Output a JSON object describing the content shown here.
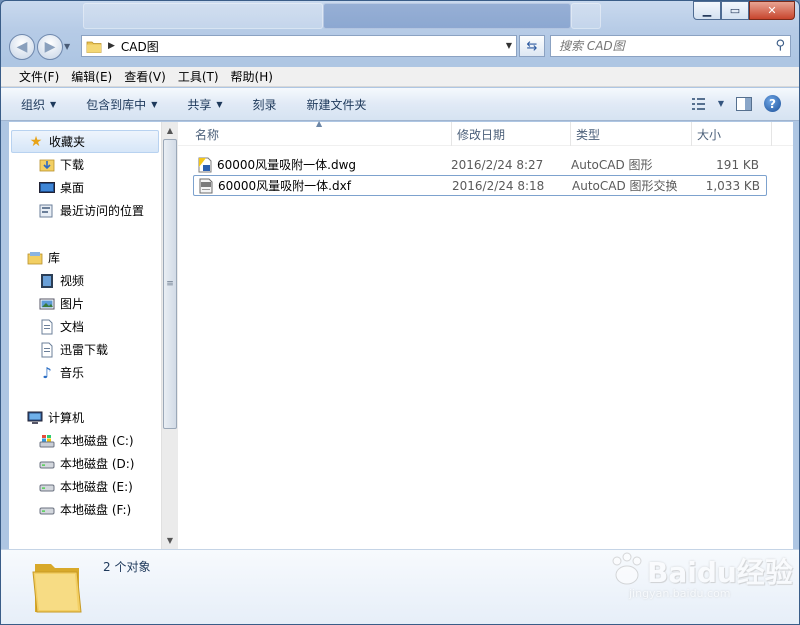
{
  "window": {
    "address_path": "CAD图",
    "search_placeholder": "搜索 CAD图"
  },
  "menu": {
    "items": [
      "文件(F)",
      "编辑(E)",
      "查看(V)",
      "工具(T)",
      "帮助(H)"
    ]
  },
  "commands": {
    "organize": "组织",
    "include_in_library": "包含到库中",
    "share": "共享",
    "burn": "刻录",
    "new_folder": "新建文件夹"
  },
  "nav": {
    "favorites": {
      "label": "收藏夹",
      "items": [
        "下载",
        "桌面",
        "最近访问的位置"
      ]
    },
    "libraries": {
      "label": "库",
      "items": [
        "视频",
        "图片",
        "文档",
        "迅雷下载",
        "音乐"
      ]
    },
    "computer": {
      "label": "计算机",
      "items": [
        "本地磁盘 (C:)",
        "本地磁盘 (D:)",
        "本地磁盘 (E:)",
        "本地磁盘 (F:)"
      ]
    }
  },
  "columns": {
    "name": "名称",
    "date": "修改日期",
    "type": "类型",
    "size": "大小"
  },
  "files": [
    {
      "name": "60000风量吸附一体.dwg",
      "date": "2016/2/24 8:27",
      "type": "AutoCAD 图形",
      "size": "191 KB"
    },
    {
      "name": "60000风量吸附一体.dxf",
      "date": "2016/2/24 8:18",
      "type": "AutoCAD 图形交换",
      "size": "1,033 KB"
    }
  ],
  "details": {
    "count": "2 个对象"
  },
  "watermark": {
    "main": "Baidu经验",
    "sub": "jingyan.baidu.com"
  },
  "colors": {
    "accent": "#1e395b",
    "selection_border": "#7da2ce",
    "close_button": "#c7452d"
  }
}
